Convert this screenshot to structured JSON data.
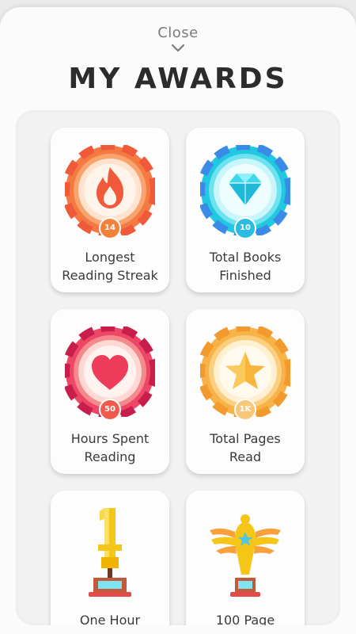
{
  "header": {
    "close_label": "Close",
    "title": "MY AWARDS"
  },
  "awards": [
    {
      "line1": "Longest",
      "line2": "Reading Streak",
      "count": "14",
      "icon": "flame-icon",
      "accent": "#f06a3a"
    },
    {
      "line1": "Total Books",
      "line2": "Finished",
      "count": "10",
      "icon": "diamond-icon",
      "accent": "#25c9e0"
    },
    {
      "line1": "Hours Spent",
      "line2": "Reading",
      "count": "50",
      "icon": "heart-icon",
      "accent": "#ec4763"
    },
    {
      "line1": "Total Pages",
      "line2": "Read",
      "count": "1K",
      "icon": "star-icon",
      "accent": "#f5b041"
    },
    {
      "line1": "One Hour",
      "line2": "",
      "icon": "trophy-number-one-icon",
      "accent": "#f5c518"
    },
    {
      "line1": "100 Page",
      "line2": "",
      "icon": "trophy-winged-icon",
      "accent": "#f5c518"
    }
  ]
}
